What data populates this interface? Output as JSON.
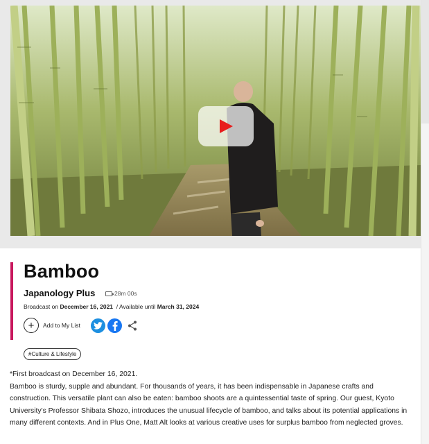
{
  "video": {
    "play_icon": "play-icon",
    "accent_color": "#e81c1c"
  },
  "program": {
    "title": "Bamboo",
    "series": "Japanology Plus",
    "duration": "28m 00s",
    "broadcast_prefix": "Broadcast on",
    "broadcast_date": "December 16, 2021",
    "available_prefix": "/ Available until",
    "available_date": "March 31, 2024",
    "accent_color": "#c8175d"
  },
  "actions": {
    "add_to_list_label": "Add to My List",
    "add_icon": "plus-icon",
    "twitter_icon": "twitter-icon",
    "facebook_icon": "facebook-icon",
    "share_icon": "share-icon"
  },
  "tags": [
    "#Culture & Lifestyle"
  ],
  "description": {
    "first_line": "*First broadcast on December 16, 2021.",
    "body": "Bamboo is sturdy, supple and abundant. For thousands of years, it has been indispensable in Japanese crafts and construction. This versatile plant can also be eaten: bamboo shoots are a quintessential taste of spring. Our guest, Kyoto University's Professor Shibata Shozo, introduces the unusual lifecycle of bamboo, and talks about its potential applications in many different contexts. And in Plus One, Matt Alt looks at various creative uses for surplus bamboo from neglected groves."
  }
}
